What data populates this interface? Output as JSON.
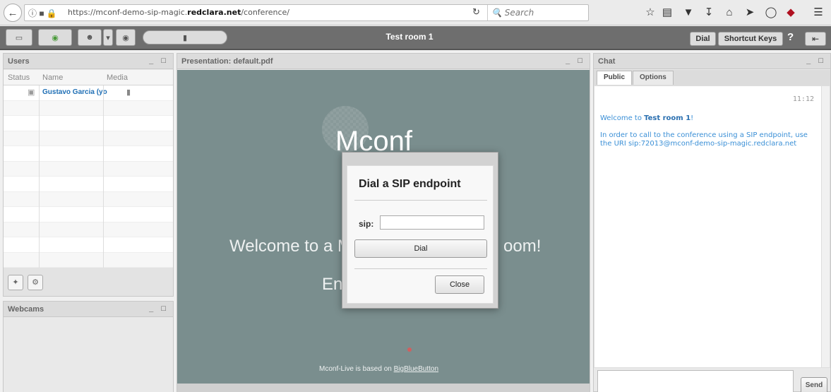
{
  "browser": {
    "url_prefix": "https://mconf-demo-sip-magic.",
    "url_domain": "redclara.net",
    "url_suffix": "/conference/",
    "search_placeholder": "Search"
  },
  "app": {
    "room_title": "Test room 1",
    "dial_label": "Dial",
    "shortcut_label": "Shortcut Keys",
    "help_label": "?"
  },
  "users": {
    "title": "Users",
    "col_status": "Status",
    "col_name": "Name",
    "col_media": "Media",
    "rows": [
      {
        "name": "Gustavo Garcia (yo"
      }
    ]
  },
  "webcams": {
    "title": "Webcams"
  },
  "presentation": {
    "title": "Presentation: default.pdf",
    "logo": "Mconf",
    "welcome_left": "Welcome to a M",
    "welcome_right": "oom!",
    "enjoy": "En",
    "based_text": "Mconf-Live is based on ",
    "based_link": "BigBlueButton"
  },
  "dialog": {
    "title": "Dial a SIP endpoint",
    "sip_label": "sip:",
    "sip_value": "",
    "dial_label": "Dial",
    "close_label": "Close"
  },
  "chat": {
    "title": "Chat",
    "tabs": [
      "Public",
      "Options"
    ],
    "time": "11:12",
    "welcome_prefix": "Welcome to ",
    "welcome_room": "Test room 1",
    "welcome_suffix": "!",
    "message": "In order to call to the conference using a SIP endpoint, use the URI sip:72013@mconf-demo-sip-magic.redclara.net",
    "send_label": "Send"
  }
}
